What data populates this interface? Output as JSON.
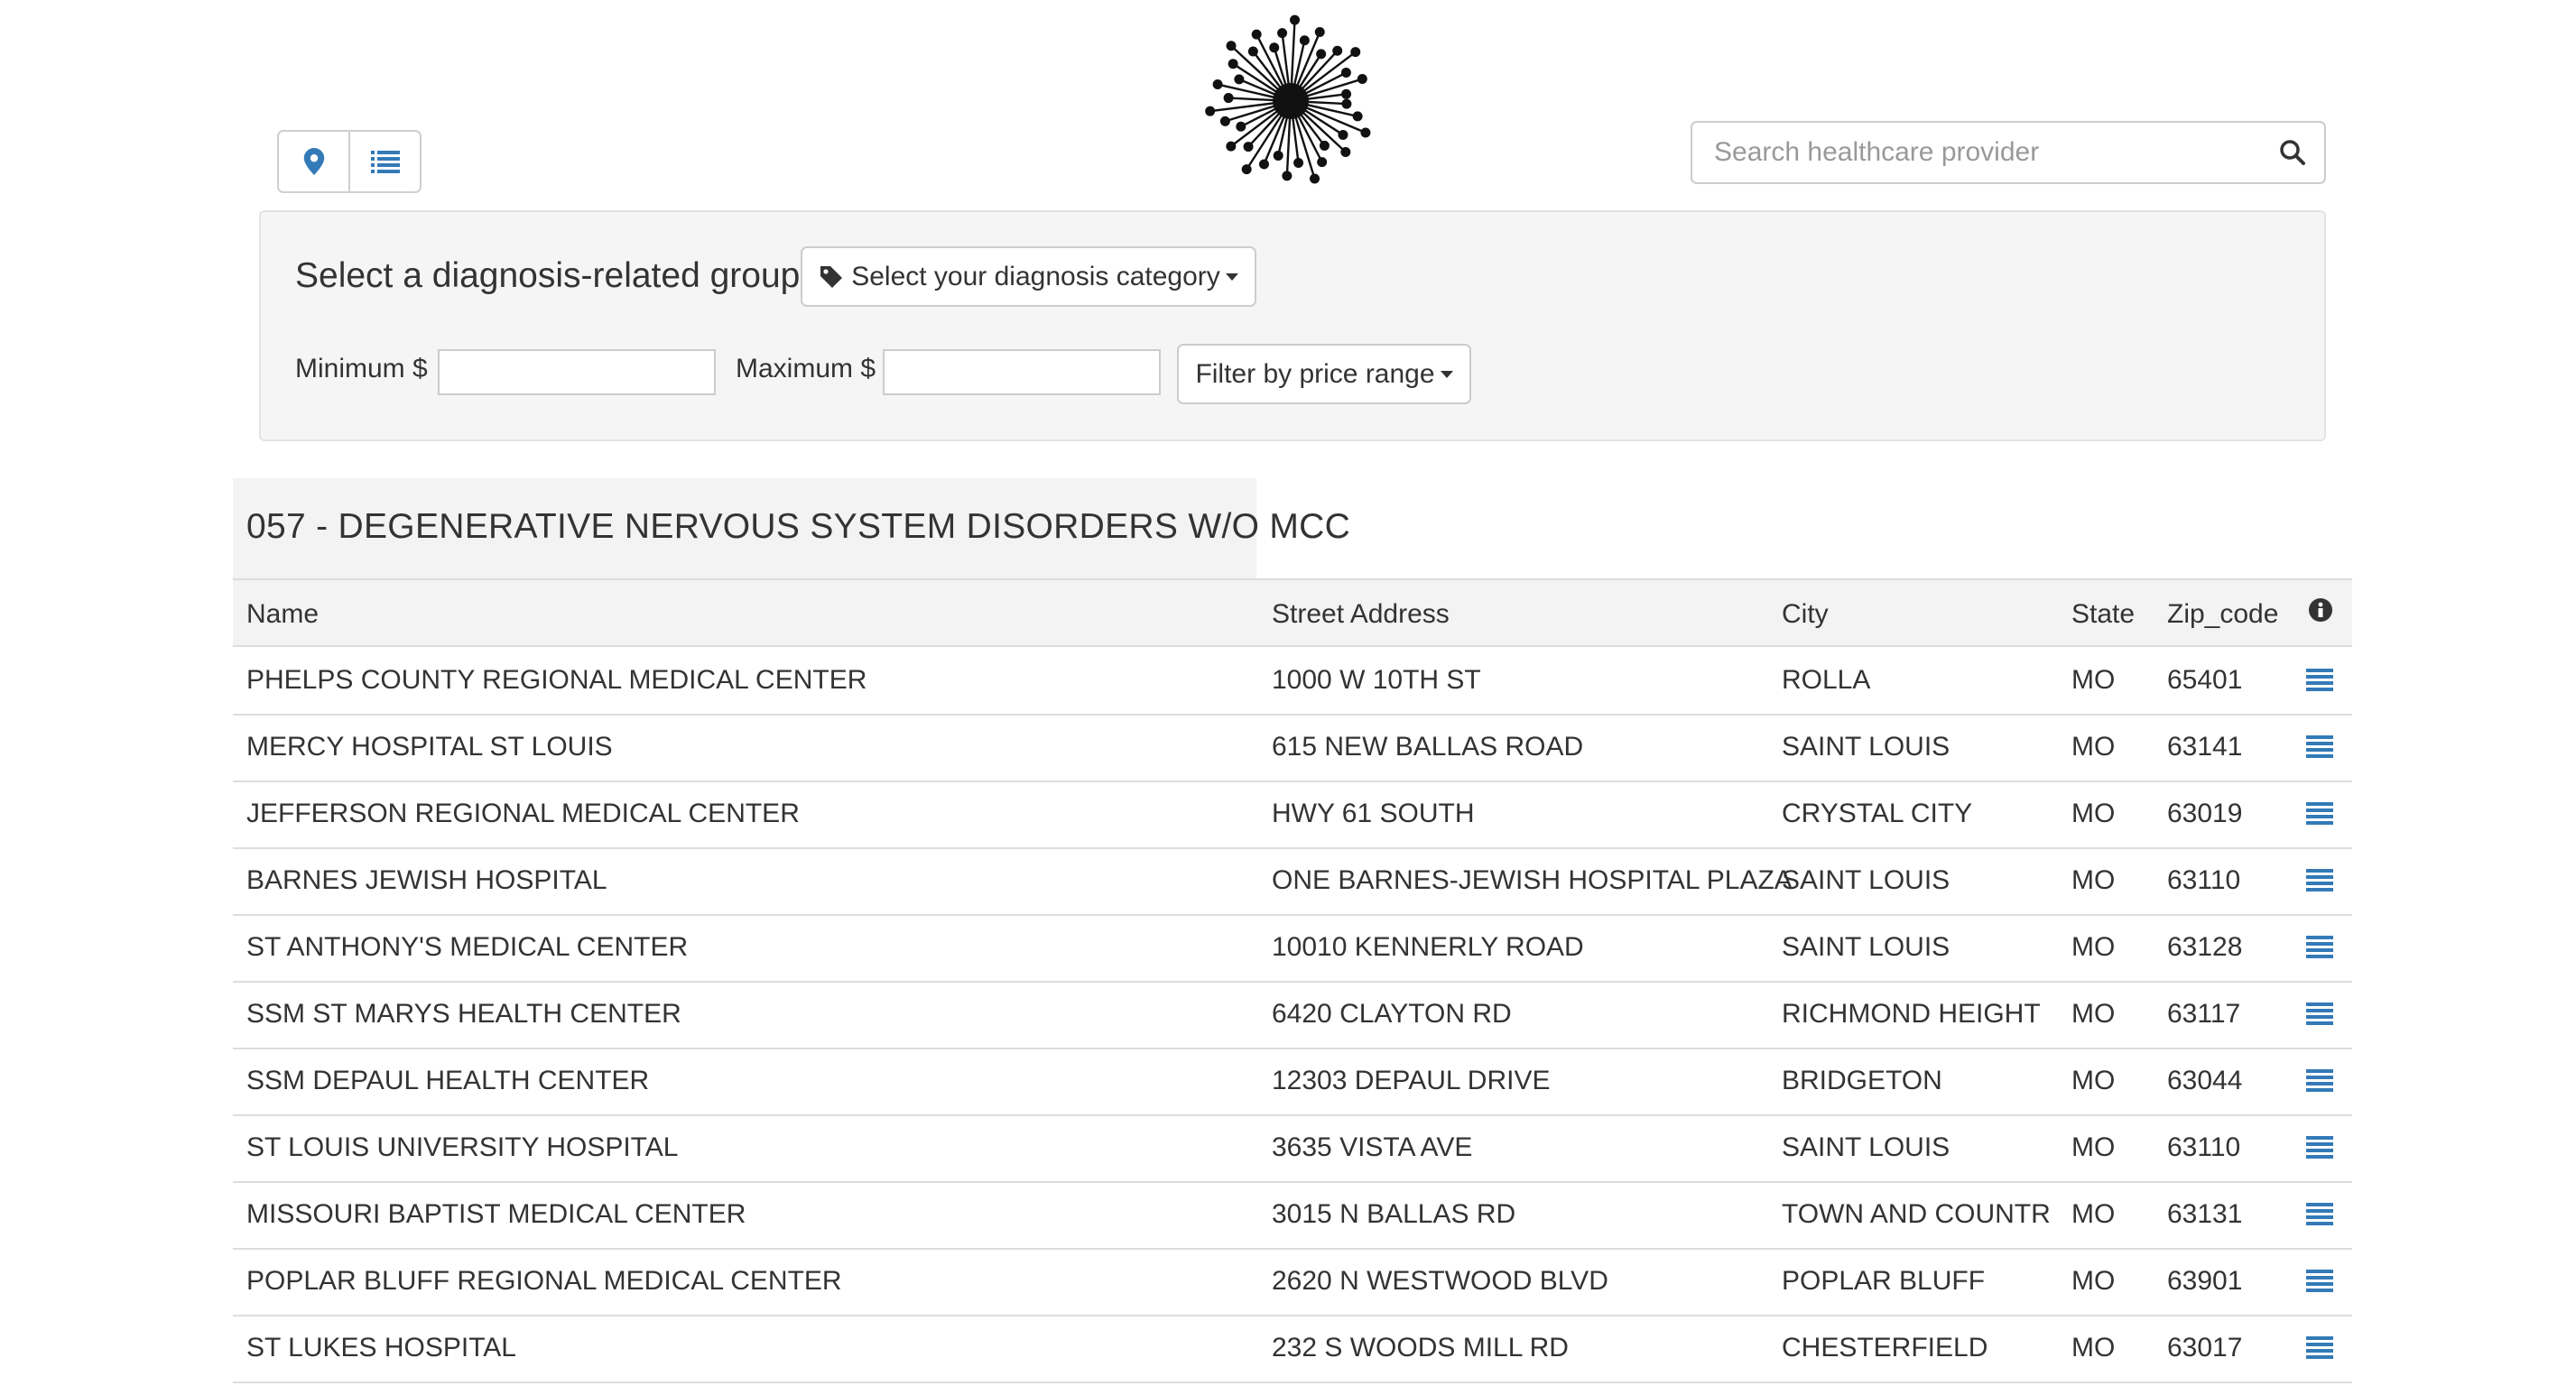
{
  "header": {
    "view_buttons": [
      {
        "icon": "map-marker-icon"
      },
      {
        "icon": "list-icon"
      }
    ],
    "logo_icon": "starburst-logo",
    "search": {
      "placeholder": "Search healthcare provider",
      "value": "",
      "icon": "search-icon"
    }
  },
  "filters": {
    "drg_label": "Select a diagnosis-related group",
    "drg_button": "Select your diagnosis category",
    "min_label": "Minimum $",
    "max_label": "Maximum $",
    "min_value": "",
    "max_value": "",
    "price_button": "Filter by price range"
  },
  "results": {
    "drg_title": "057 - DEGENERATIVE NERVOUS SYSTEM DISORDERS W/O MCC",
    "columns": [
      "Name",
      "Street Address",
      "City",
      "State",
      "Zip_code"
    ],
    "info_icon": "info-icon",
    "rows": [
      {
        "name": "PHELPS COUNTY REGIONAL MEDICAL CENTER",
        "address": "1000 W 10TH ST",
        "city": "ROLLA",
        "state": "MO",
        "zip": "65401"
      },
      {
        "name": "MERCY HOSPITAL ST LOUIS",
        "address": "615 NEW BALLAS ROAD",
        "city": "SAINT LOUIS",
        "state": "MO",
        "zip": "63141"
      },
      {
        "name": "JEFFERSON REGIONAL MEDICAL CENTER",
        "address": "HWY 61 SOUTH",
        "city": "CRYSTAL CITY",
        "state": "MO",
        "zip": "63019"
      },
      {
        "name": "BARNES JEWISH HOSPITAL",
        "address": "ONE BARNES-JEWISH HOSPITAL PLAZA",
        "city": "SAINT LOUIS",
        "state": "MO",
        "zip": "63110"
      },
      {
        "name": "ST ANTHONY'S MEDICAL CENTER",
        "address": "10010 KENNERLY ROAD",
        "city": "SAINT LOUIS",
        "state": "MO",
        "zip": "63128"
      },
      {
        "name": "SSM ST MARYS HEALTH CENTER",
        "address": "6420 CLAYTON RD",
        "city": "RICHMOND HEIGHT",
        "state": "MO",
        "zip": "63117"
      },
      {
        "name": "SSM DEPAUL HEALTH CENTER",
        "address": "12303 DEPAUL DRIVE",
        "city": "BRIDGETON",
        "state": "MO",
        "zip": "63044"
      },
      {
        "name": "ST LOUIS UNIVERSITY HOSPITAL",
        "address": "3635 VISTA AVE",
        "city": "SAINT LOUIS",
        "state": "MO",
        "zip": "63110"
      },
      {
        "name": "MISSOURI BAPTIST MEDICAL CENTER",
        "address": "3015 N BALLAS RD",
        "city": "TOWN AND COUNTR",
        "state": "MO",
        "zip": "63131"
      },
      {
        "name": "POPLAR BLUFF REGIONAL MEDICAL CENTER",
        "address": "2620 N WESTWOOD BLVD",
        "city": "POPLAR BLUFF",
        "state": "MO",
        "zip": "63901"
      },
      {
        "name": "ST LUKES HOSPITAL",
        "address": "232 S WOODS MILL RD",
        "city": "CHESTERFIELD",
        "state": "MO",
        "zip": "63017"
      }
    ],
    "row_action_icon": "details-list-icon"
  },
  "colors": {
    "accent": "#337ab7",
    "text": "#333333",
    "panel": "#f5f5f5",
    "border": "#dddddd"
  }
}
